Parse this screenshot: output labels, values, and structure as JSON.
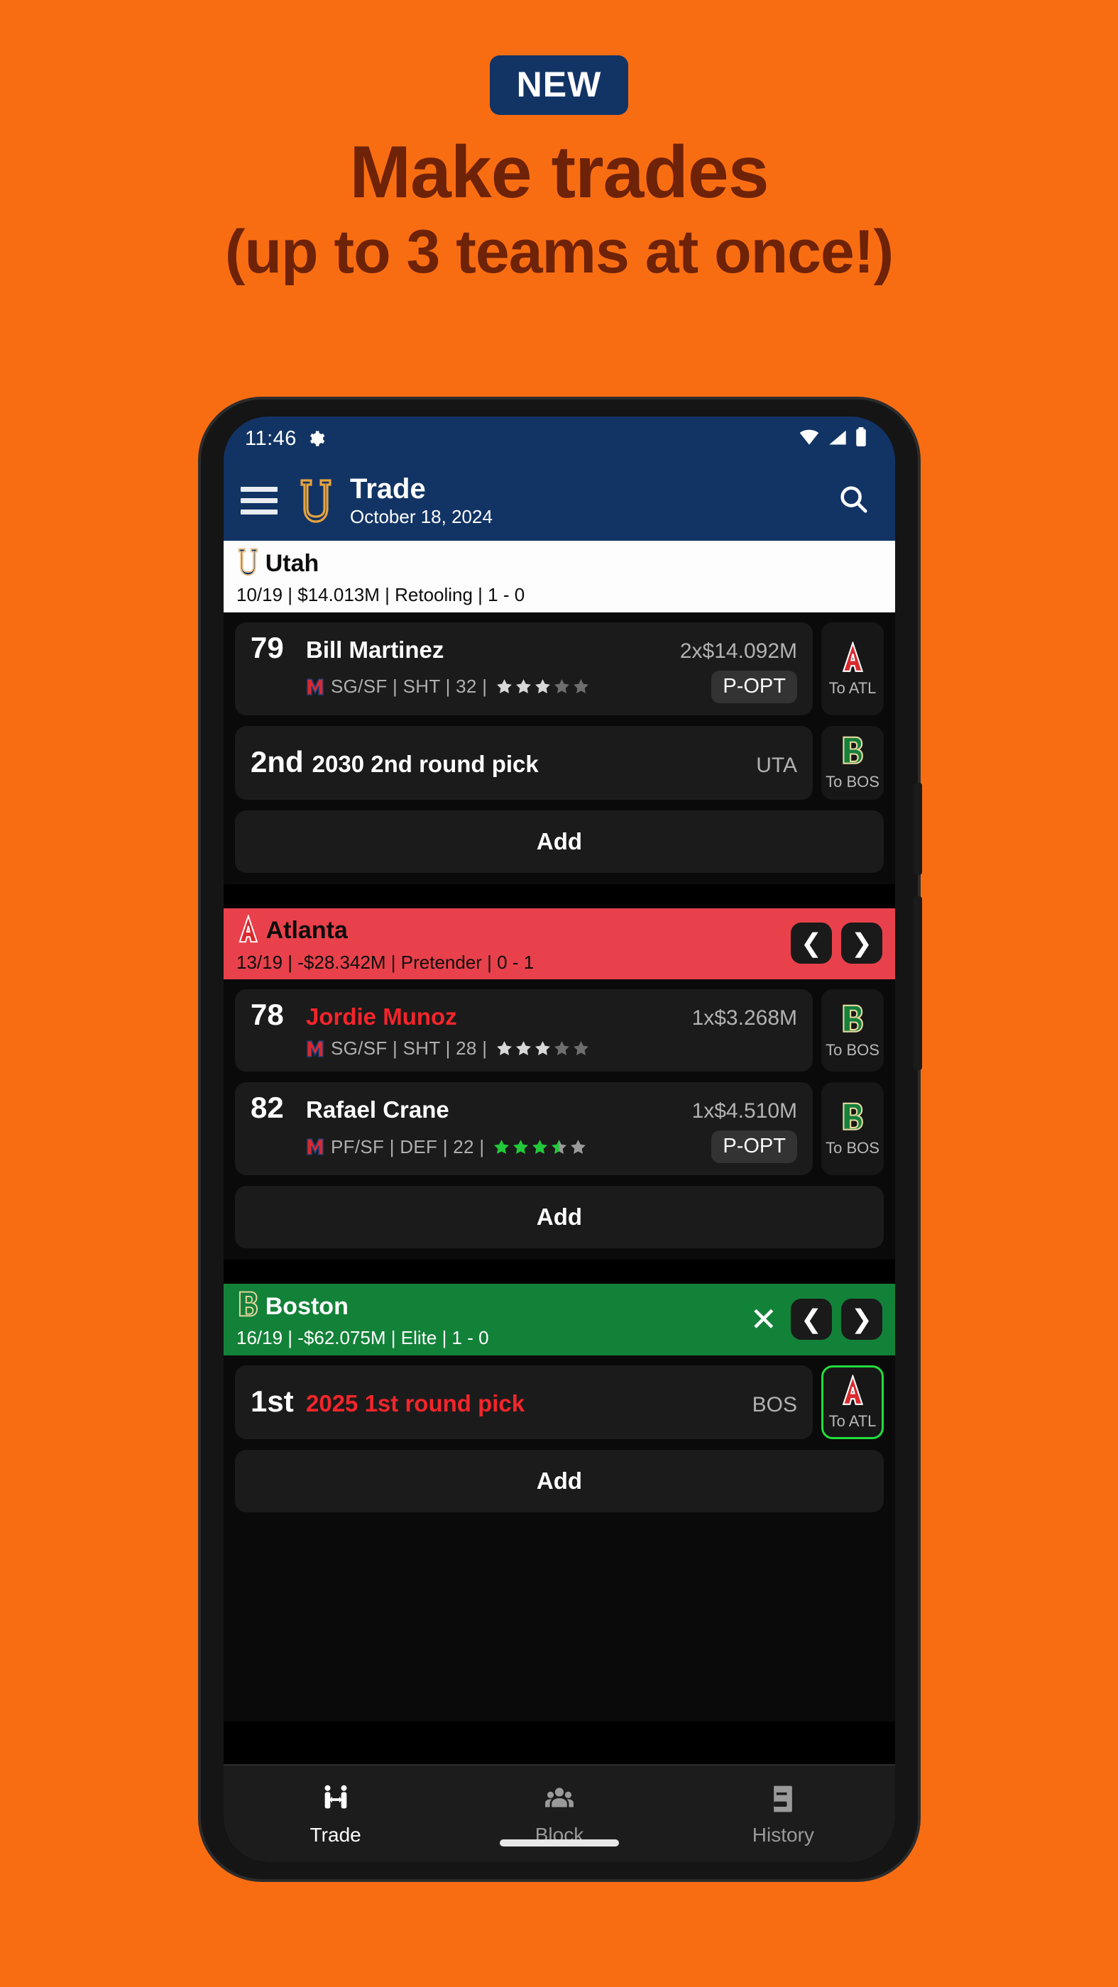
{
  "promo": {
    "badge": "NEW",
    "headline_line1": "Make trades",
    "headline_line2": "(up to 3 teams at once!)",
    "bg_color": "#F96D12",
    "badge_bg": "#123465",
    "headline_color": "#6E2208"
  },
  "status_bar": {
    "time": "11:46",
    "icons": [
      "gear-icon",
      "wifi-icon",
      "signal-icon",
      "battery-icon"
    ]
  },
  "app_bar": {
    "menu_icon": "hamburger-menu-icon",
    "logo": "utah-u-logo",
    "title": "Trade",
    "date": "October 18, 2024",
    "search_icon": "search-icon",
    "bg_color": "#123465"
  },
  "teams": [
    {
      "id": "utah",
      "abbr": "UTA",
      "logo": "utah-u-logo",
      "name": "Utah",
      "subtitle": "10/19 | $14.013M | Retooling | 1 - 0",
      "header_bg": "#fdfdfd",
      "header_text": "#0d0d0d",
      "has_close": false,
      "has_nav": false,
      "add_label": "Add",
      "assets": [
        {
          "kind": "player",
          "ovr": "79",
          "name": "Bill Martinez",
          "name_color": "white",
          "contract": "2x$14.092M",
          "college_logo": "college-m-logo-red",
          "meta": "SG/SF | SHT | 32 |",
          "stars_filled": 3,
          "stars_total": 5,
          "star_color": "#d8d8d8",
          "star_empty_color": "#6e6e6e",
          "badge": "P-OPT",
          "dest_logo": "atlanta-a-logo",
          "dest_label": "To ATL",
          "dest_selected": false
        },
        {
          "kind": "pick",
          "ord": "2nd",
          "text": "2030 2nd round pick",
          "text_color": "white",
          "from": "UTA",
          "dest_logo": "boston-b-logo",
          "dest_label": "To BOS",
          "dest_selected": false
        }
      ]
    },
    {
      "id": "atlanta",
      "abbr": "ATL",
      "logo": "atlanta-a-logo",
      "name": "Atlanta",
      "subtitle": "13/19 | -$28.342M | Pretender | 0 - 1",
      "header_bg": "#E8414B",
      "header_text": "#0d0d0d",
      "has_close": false,
      "has_nav": true,
      "prev_icon": "chevron-left-icon",
      "next_icon": "chevron-right-icon",
      "add_label": "Add",
      "assets": [
        {
          "kind": "player",
          "ovr": "78",
          "name": "Jordie Munoz",
          "name_color": "red",
          "contract": "1x$3.268M",
          "college_logo": "college-m-logo-red",
          "meta": "SG/SF | SHT | 28 |",
          "stars_filled": 3,
          "stars_total": 5,
          "star_color": "#d8d8d8",
          "star_empty_color": "#6e6e6e",
          "badge": "",
          "dest_logo": "boston-b-logo",
          "dest_label": "To BOS",
          "dest_selected": false
        },
        {
          "kind": "player",
          "ovr": "82",
          "name": "Rafael Crane",
          "name_color": "white",
          "contract": "1x$4.510M",
          "college_logo": "college-m-logo-red",
          "meta": "PF/SF | DEF | 22 |",
          "stars_filled": 3.5,
          "stars_total": 5,
          "star_color": "#22C93A",
          "star_empty_color": "#9a9a9a",
          "badge": "P-OPT",
          "dest_logo": "boston-b-logo",
          "dest_label": "To BOS",
          "dest_selected": false
        }
      ]
    },
    {
      "id": "boston",
      "abbr": "BOS",
      "logo": "boston-b-logo",
      "name": "Boston",
      "subtitle": "16/19 | -$62.075M | Elite | 1 - 0",
      "header_bg": "#138239",
      "header_text": "#ffffff",
      "has_close": true,
      "close_icon": "close-x-icon",
      "has_nav": true,
      "prev_icon": "chevron-left-icon",
      "next_icon": "chevron-right-icon",
      "add_label": "Add",
      "assets": [
        {
          "kind": "pick",
          "ord": "1st",
          "text": "2025 1st round pick",
          "text_color": "red",
          "from": "BOS",
          "dest_logo": "atlanta-a-logo",
          "dest_label": "To ATL",
          "dest_selected": true
        }
      ]
    }
  ],
  "bottom_nav": {
    "items": [
      {
        "label": "Trade",
        "icon": "trade-handshake-icon",
        "active": true
      },
      {
        "label": "Block",
        "icon": "people-group-icon",
        "active": false
      },
      {
        "label": "History",
        "icon": "book-history-icon",
        "active": false
      }
    ]
  }
}
